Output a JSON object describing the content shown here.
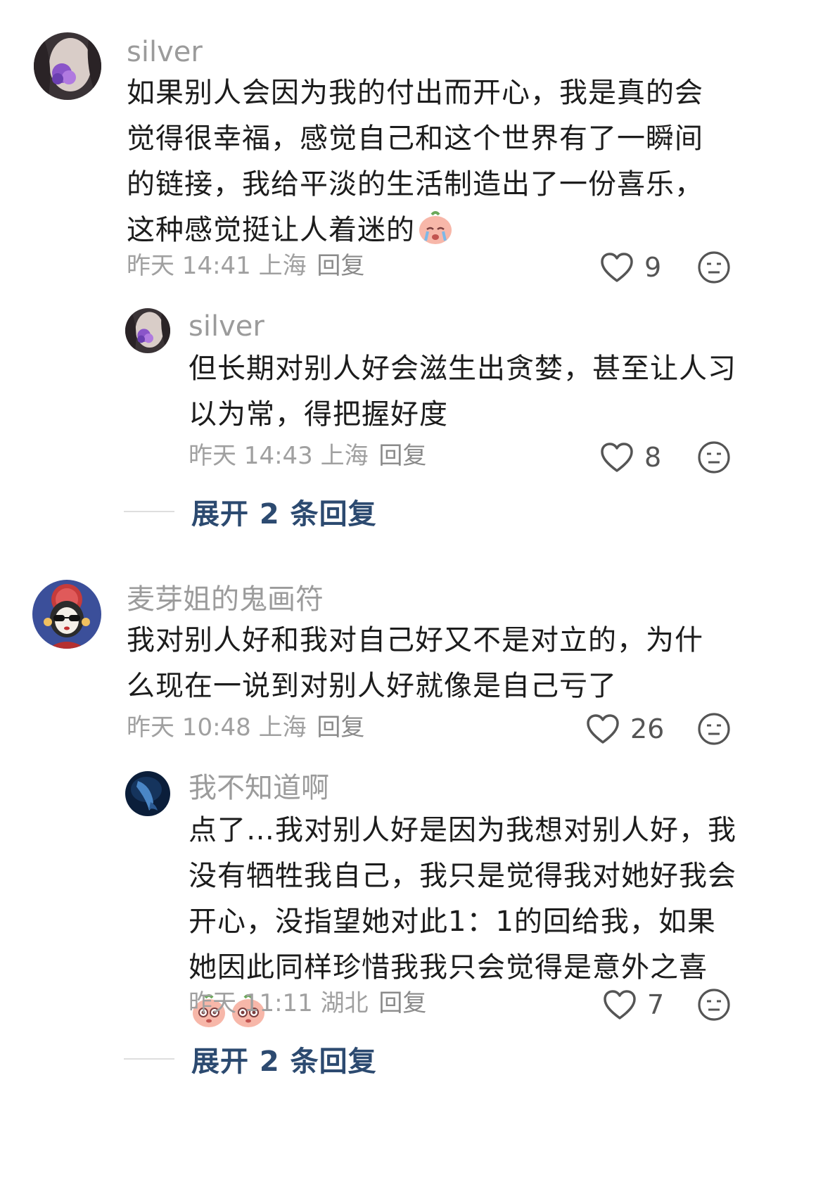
{
  "comments": [
    {
      "username": "silver",
      "text": "如果别人会因为我的付出而开心，我是真的会觉得很幸福，感觉自己和这个世界有了一瞬间的链接，我给平淡的生活制造出了一份喜乐，这种感觉挺让人着迷的",
      "emoji": "crying-peach-emoji",
      "time": "昨天 14:41 上海",
      "reply_label": "回复",
      "likes": "9",
      "replies": [
        {
          "username": "silver",
          "text": "但长期对别人好会滋生出贪婪，甚至让人习以为常，得把握好度",
          "time": "昨天 14:43 上海",
          "reply_label": "回复",
          "likes": "8"
        }
      ],
      "expand_label": "展开 2 条回复"
    },
    {
      "username": "麦芽姐的鬼画符",
      "text": "我对别人好和我对自己好又不是对立的，为什么现在一说到对别人好就像是自己亏了",
      "time": "昨天 10:48 上海",
      "reply_label": "回复",
      "likes": "26",
      "replies": [
        {
          "username": "我不知道啊",
          "text": "点了…我对别人好是因为我想对别人好，我没有牺牲我自己，我只是觉得我对她好我会开心，没指望她对此1：1的回给我，如果她因此同样珍惜我我只会觉得是意外之喜",
          "emoji": "peach-emoji",
          "time": "昨天 11:11 湖北",
          "reply_label": "回复",
          "likes": "7"
        }
      ],
      "expand_label": "展开 2 条回复"
    }
  ],
  "colors": {
    "username": "#9b9b9b",
    "meta": "#a0a0a0",
    "expand": "#2c4a70"
  }
}
